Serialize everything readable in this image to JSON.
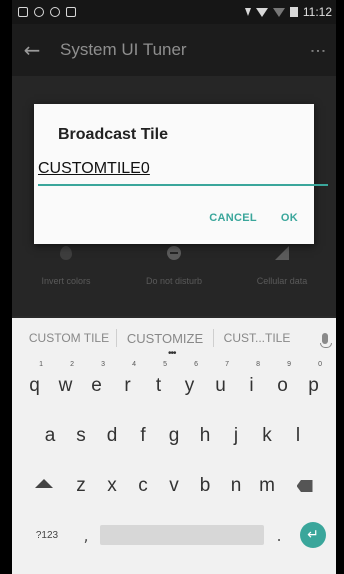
{
  "status_bar": {
    "time": "11:12"
  },
  "toolbar": {
    "title": "System UI Tuner",
    "back_icon": "←",
    "overflow_icon": "⋮"
  },
  "tiles": [
    {
      "label": "Invert colors"
    },
    {
      "label": "Do not disturb"
    },
    {
      "label": "Cellular data"
    }
  ],
  "dialog": {
    "title": "Broadcast Tile",
    "input_value": "CUSTOMTILE0",
    "cancel_label": "CANCEL",
    "ok_label": "OK"
  },
  "suggestions": [
    "CUSTOM TILE",
    "CUSTOMIZE",
    "CUST...TILE"
  ],
  "keyboard": {
    "row1": [
      {
        "k": "q",
        "n": "1"
      },
      {
        "k": "w",
        "n": "2"
      },
      {
        "k": "e",
        "n": "3"
      },
      {
        "k": "r",
        "n": "4"
      },
      {
        "k": "t",
        "n": "5"
      },
      {
        "k": "y",
        "n": "6"
      },
      {
        "k": "u",
        "n": "7"
      },
      {
        "k": "i",
        "n": "8"
      },
      {
        "k": "o",
        "n": "9"
      },
      {
        "k": "p",
        "n": "0"
      }
    ],
    "row2": [
      "a",
      "s",
      "d",
      "f",
      "g",
      "h",
      "j",
      "k",
      "l"
    ],
    "row3": [
      "z",
      "x",
      "c",
      "v",
      "b",
      "n",
      "m"
    ],
    "symbols_label": "?123",
    "comma": ",",
    "period": ".",
    "enter_icon": "↵"
  },
  "colors": {
    "accent": "#3aa69b"
  }
}
